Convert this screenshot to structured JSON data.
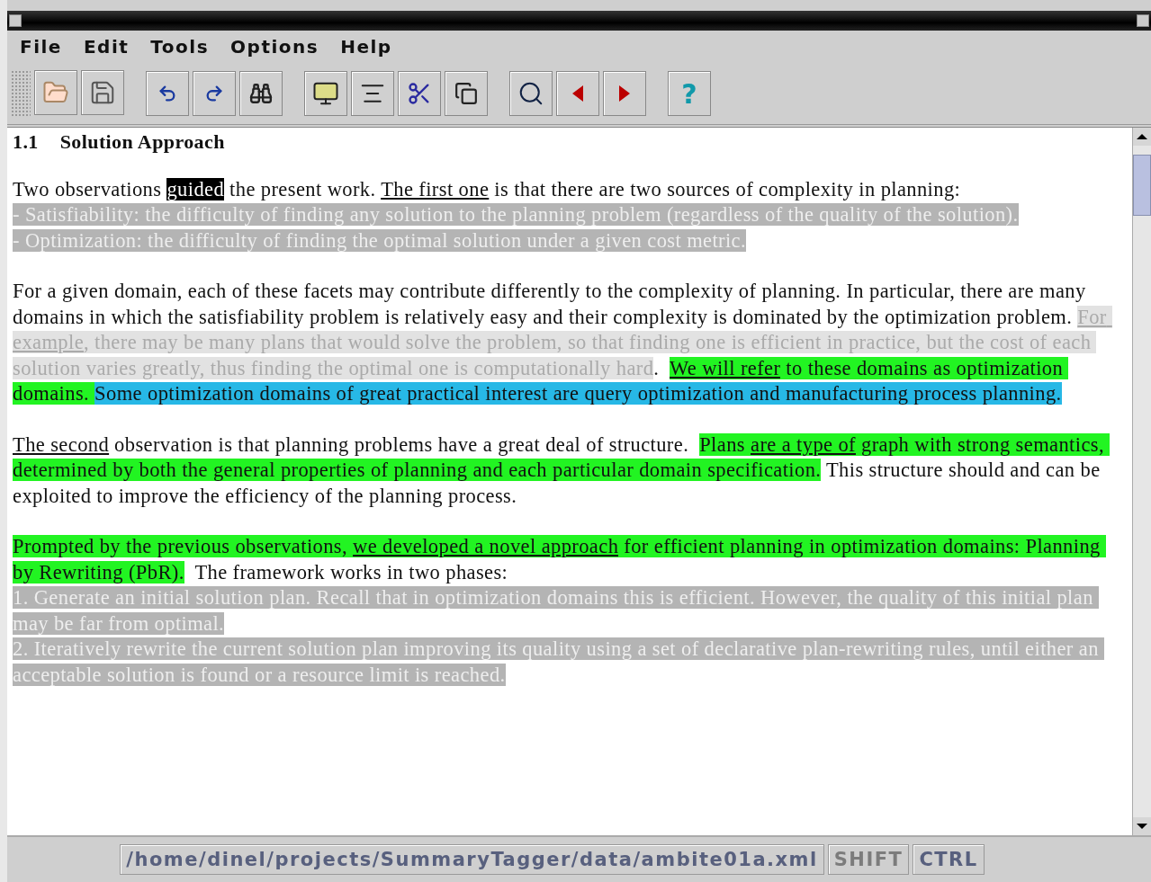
{
  "menu": [
    "File",
    "Edit",
    "Tools",
    "Options",
    "Help"
  ],
  "toolbar": {
    "help_label": "?"
  },
  "heading": {
    "number": "1.1",
    "title": "Solution Approach"
  },
  "document": [
    {
      "kind": "paragraph",
      "segments": [
        {
          "text": "Two observations ",
          "kind": "plain",
          "underlined": false
        },
        {
          "text": "guided",
          "kind": "selected",
          "underlined": false
        },
        {
          "text": " the present work. ",
          "kind": "plain",
          "underlined": false
        },
        {
          "text": "The first one",
          "kind": "plain",
          "underlined": true
        },
        {
          "text": " is that there are two sources of complexity in planning:",
          "kind": "plain",
          "underlined": false
        }
      ]
    },
    {
      "kind": "item",
      "segments": [
        {
          "text": "- Satisfiability: the difficulty of finding any solution to the planning problem (regardless of the quality of the solution).",
          "kind": "dark",
          "underlined": false
        }
      ]
    },
    {
      "kind": "item",
      "segments": [
        {
          "text": "- Optimization: the difficulty of finding the optimal solution under a given cost metric.",
          "kind": "dark",
          "underlined": false
        }
      ]
    },
    {
      "kind": "paragraph",
      "segments": [
        {
          "text": "For a given domain, each of these facets may contribute differently to the complexity of planning. In particular, there are many domains in which the satisfiability problem is relatively easy and their complexity is dominated by the optimization problem. ",
          "kind": "plain",
          "underlined": false
        },
        {
          "text": "For example",
          "kind": "light",
          "underlined": true
        },
        {
          "text": ", there may be many plans that would solve the problem, so that finding one is efficient in practice, but the cost of each solution varies greatly, thus finding the optimal one is computationally hard",
          "kind": "light",
          "underlined": false
        },
        {
          "text": ".  ",
          "kind": "plain",
          "underlined": false
        },
        {
          "text": "We will refer",
          "kind": "green",
          "underlined": true
        },
        {
          "text": " to these domains as optimization domains. ",
          "kind": "green",
          "underlined": false
        },
        {
          "text": "Some optimization domains of great practical interest are query optimization and manufacturing process planning.",
          "kind": "blue",
          "underlined": false
        }
      ]
    },
    {
      "kind": "paragraph",
      "segments": [
        {
          "text": "The second",
          "kind": "plain",
          "underlined": true
        },
        {
          "text": " observation is that planning problems have a great deal of structure.  ",
          "kind": "plain",
          "underlined": false
        },
        {
          "text": "Plans ",
          "kind": "green",
          "underlined": false
        },
        {
          "text": "are a type of",
          "kind": "green",
          "underlined": true
        },
        {
          "text": " graph with strong semantics, determined by both the general properties of planning and each particular domain specification.",
          "kind": "green",
          "underlined": false
        },
        {
          "text": " This structure should and can be exploited to improve the efficiency of the planning process.",
          "kind": "plain",
          "underlined": false
        }
      ]
    },
    {
      "kind": "paragraph",
      "segments": [
        {
          "text": "Prompted by the previous observations, ",
          "kind": "green",
          "underlined": false
        },
        {
          "text": "we developed a novel approach",
          "kind": "green",
          "underlined": true
        },
        {
          "text": " for efficient planning in optimization domains: Planning by Rewriting (PbR).",
          "kind": "green",
          "underlined": false
        },
        {
          "text": "  The framework works in two phases:",
          "kind": "plain",
          "underlined": false
        }
      ]
    },
    {
      "kind": "item",
      "segments": [
        {
          "text": "1. Generate an initial solution plan. Recall that in optimization domains this is efficient. However, the quality of this initial plan may be far from optimal.",
          "kind": "dark",
          "underlined": false
        }
      ]
    },
    {
      "kind": "item",
      "segments": [
        {
          "text": "2. Iteratively rewrite the current solution plan improving its quality using a set of declarative plan-rewriting rules, until either an acceptable solution is found or a resource limit is reached.",
          "kind": "dark",
          "underlined": false
        }
      ]
    }
  ],
  "status_bar": {
    "path": "/home/dinel/projects/SummaryTagger/data/ambite01a.xml",
    "keys": [
      {
        "label": "SHIFT",
        "active": false
      },
      {
        "label": "CTRL",
        "active": true
      }
    ]
  }
}
